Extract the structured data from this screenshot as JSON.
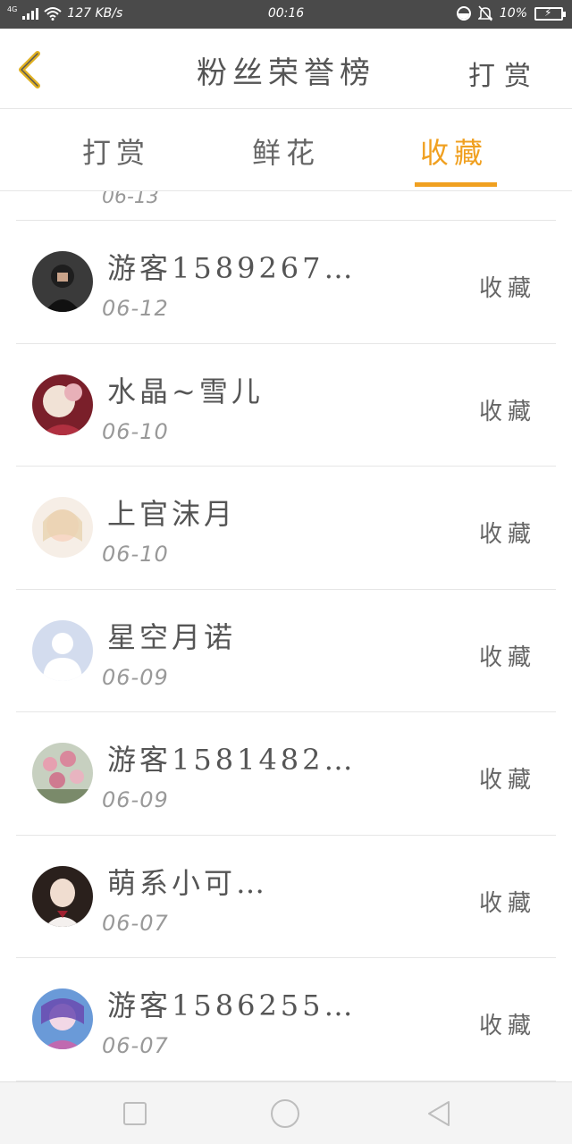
{
  "status_bar": {
    "network_type": "4G",
    "speed": "127 KB/s",
    "time": "00:16",
    "battery": "10%"
  },
  "header": {
    "title": "粉丝荣誉榜",
    "action": "打赏",
    "back_icon": "chevron-left-icon"
  },
  "tabs": [
    {
      "label": "打赏",
      "active": false
    },
    {
      "label": "鲜花",
      "active": false
    },
    {
      "label": "收藏",
      "active": true
    }
  ],
  "accent_color": "#f0a020",
  "list": {
    "cut_off_date": "06-13",
    "items": [
      {
        "name": "游客1589267…",
        "date": "06-12",
        "action": "收藏"
      },
      {
        "name": "水晶~雪儿",
        "date": "06-10",
        "action": "收藏"
      },
      {
        "name": "上官沫月",
        "date": "06-10",
        "action": "收藏"
      },
      {
        "name": "星空月诺",
        "date": "06-09",
        "action": "收藏"
      },
      {
        "name": "游客1581482…",
        "date": "06-09",
        "action": "收藏"
      },
      {
        "name": "萌系小可…",
        "date": "06-07",
        "action": "收藏"
      },
      {
        "name": "游客1586255…",
        "date": "06-07",
        "action": "收藏"
      }
    ]
  },
  "nav_bar": {
    "recent_icon": "square-icon",
    "home_icon": "circle-icon",
    "back_icon": "triangle-back-icon"
  }
}
